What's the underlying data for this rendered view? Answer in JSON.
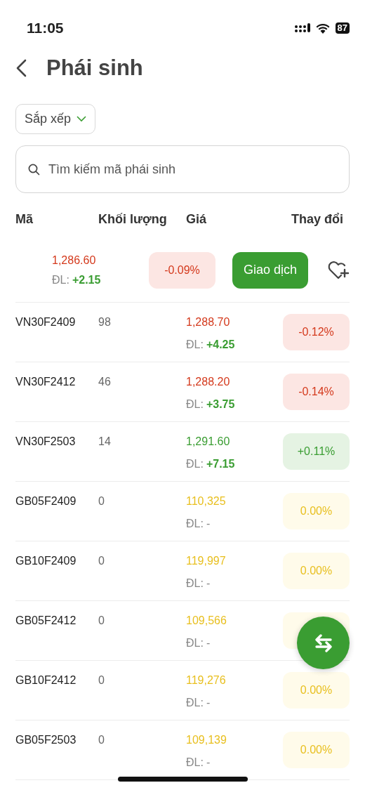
{
  "status_bar": {
    "time": "11:05",
    "battery": "87"
  },
  "header": {
    "title": "Phái sinh"
  },
  "sort": {
    "label": "Sắp xếp"
  },
  "search": {
    "placeholder": "Tìm kiếm mã phái sinh"
  },
  "columns": [
    "Mã",
    "Khối lượng",
    "Giá",
    "Thay đổi"
  ],
  "summary": {
    "price": "1,286.60",
    "dl_label": "ĐL:",
    "dl_value": "+2.15",
    "change": "-0.09%",
    "kind": "down",
    "button": "Giao dịch"
  },
  "rows": [
    {
      "code": "VN30F2409",
      "volume": "98",
      "price": "1,288.70",
      "dl_label": "ĐL:",
      "dl_value": "+4.25",
      "change": "-0.12%",
      "kind": "down"
    },
    {
      "code": "VN30F2412",
      "volume": "46",
      "price": "1,288.20",
      "dl_label": "ĐL:",
      "dl_value": "+3.75",
      "change": "-0.14%",
      "kind": "down"
    },
    {
      "code": "VN30F2503",
      "volume": "14",
      "price": "1,291.60",
      "dl_label": "ĐL:",
      "dl_value": "+7.15",
      "change": "+0.11%",
      "kind": "up"
    },
    {
      "code": "GB05F2409",
      "volume": "0",
      "price": "110,325",
      "dl_label": "ĐL:",
      "dl_value": "-",
      "change": "0.00%",
      "kind": "flat"
    },
    {
      "code": "GB10F2409",
      "volume": "0",
      "price": "119,997",
      "dl_label": "ĐL:",
      "dl_value": "-",
      "change": "0.00%",
      "kind": "flat"
    },
    {
      "code": "GB05F2412",
      "volume": "0",
      "price": "109,566",
      "dl_label": "ĐL:",
      "dl_value": "-",
      "kind": "flat"
    },
    {
      "code": "GB10F2412",
      "volume": "0",
      "price": "119,276",
      "dl_label": "ĐL:",
      "dl_value": "-",
      "change": "0.00%",
      "kind": "flat"
    },
    {
      "code": "GB05F2503",
      "volume": "0",
      "price": "109,139",
      "dl_label": "ĐL:",
      "dl_value": "-",
      "change": "0.00%",
      "kind": "flat"
    }
  ]
}
